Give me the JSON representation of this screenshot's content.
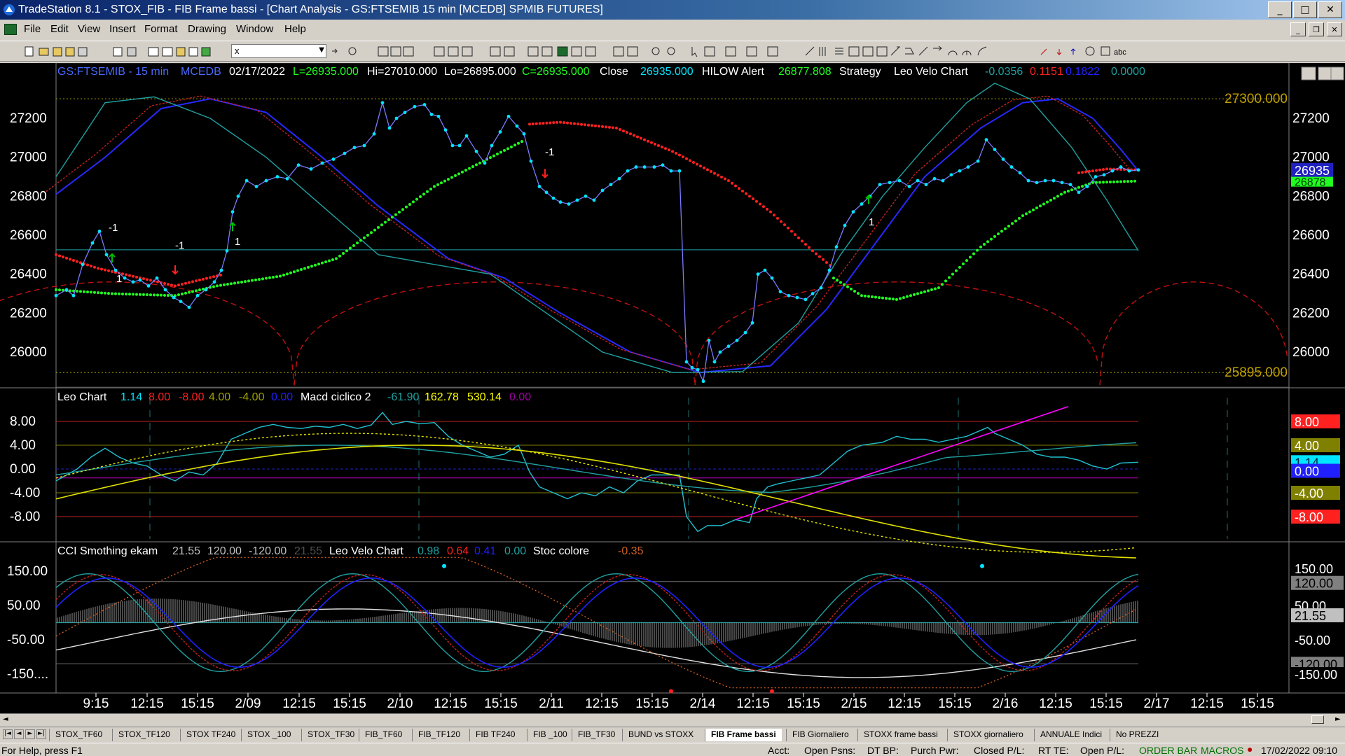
{
  "window": {
    "title": "TradeStation 8.1 - STOX_FIB - FIB Frame bassi - [Chart Analysis - GS:FTSEMIB  15 min  [MCEDB] SPMIB FUTURES]",
    "min": "_",
    "max": "□",
    "close": "✕"
  },
  "menu": [
    "File",
    "Edit",
    "View",
    "Insert",
    "Format",
    "Drawing",
    "Window",
    "Help"
  ],
  "toolbar": {
    "symbol": "x"
  },
  "price_panel": {
    "header": {
      "symbol": "GS:FTSEMIB - 15 min",
      "feed": "MCEDB",
      "date": "02/17/2022",
      "last": "L=26935.000",
      "high": "Hi=27010.000",
      "low": "Lo=26895.000",
      "close_val": "C=26935.000",
      "close_label": "Close",
      "close_num": "26935.000",
      "alert_label": "HILOW Alert",
      "alert_val": "26877.808",
      "strategy": "Strategy",
      "velo_label": "Leo Velo Chart",
      "v1": "-0.0356",
      "v2": "0.1151",
      "v3": "0.1822",
      "v4": "0.0000"
    },
    "y_ticks": [
      "27200",
      "27000",
      "26800",
      "26600",
      "26400",
      "26200",
      "26000"
    ],
    "hi_label": "27300.000",
    "lo_label": "25895.000",
    "last_price_tag": "26935",
    "alert_tag": "26878",
    "markers": [
      "-1",
      "1",
      "-1",
      "1",
      "-1",
      "1"
    ]
  },
  "osc_panel": {
    "header": {
      "name": "Leo Chart",
      "v1": "1.14",
      "v2": "8.00",
      "v3": "-8.00",
      "v4": "4.00",
      "v5": "-4.00",
      "v6": "0.00",
      "name2": "Macd ciclico 2",
      "m1": "-61.90",
      "m2": "162.78",
      "m3": "530.14",
      "m4": "0.00"
    },
    "y_ticks": [
      "8.00",
      "4.00",
      "0.00",
      "-4.00",
      "-8.00"
    ],
    "tags": [
      "8.00",
      "4.00",
      "1.14",
      "0.00",
      "-4.00",
      "-8.00"
    ]
  },
  "cci_panel": {
    "header": {
      "name": "CCI Smothing ekam",
      "v1": "21.55",
      "v2": "120.00",
      "v3": "-120.00",
      "v4": "21.55",
      "name2": "Leo Velo Chart",
      "l1": "0.98",
      "l2": "0.64",
      "l3": "0.41",
      "l4": "0.00",
      "name3": "Stoc colore",
      "s1": "-0.35"
    },
    "y_ticks": [
      "150.00",
      "50.00",
      "-50.00",
      "-150...."
    ],
    "tags": [
      "150.00",
      "120.00",
      "50.00",
      "21.55",
      "-50.00",
      "-120.00",
      "-150.00"
    ]
  },
  "time_axis": [
    "9:15",
    "12:15",
    "15:15",
    "2/09",
    "12:15",
    "15:15",
    "2/10",
    "12:15",
    "15:15",
    "2/11",
    "12:15",
    "15:15",
    "2/14",
    "12:15",
    "15:15",
    "2/15",
    "12:15",
    "15:15",
    "2/16",
    "12:15",
    "15:15",
    "2/17",
    "12:15",
    "15:15"
  ],
  "tabs": [
    "STOX_TF60",
    "STOX_TF120",
    "STOX TF240",
    "STOX _100",
    "STOX_TF30",
    "FIB_TF60",
    "FIB_TF120",
    "FIB TF240",
    "FIB _100",
    "FIB_TF30",
    "BUND vs STOXX",
    "FIB Frame bassi",
    "FIB Giornaliero",
    "STOXX frame bassi",
    "STOXX giornaliero",
    "ANNUALE Indici",
    "No PREZZI"
  ],
  "active_tab": "FIB Frame bassi",
  "status": {
    "help": "For Help, press F1",
    "acct": "Acct:",
    "open_psns": "Open Psns:",
    "dt_bp": "DT BP:",
    "purch_pwr": "Purch Pwr:",
    "closed_pl": "Closed P/L:",
    "rt_te": "RT TE:",
    "open_pl": "Open P/L:",
    "order_bar": "ORDER BAR",
    "macros": "MACROS",
    "datetime": "17/02/2022 09:10"
  },
  "colors": {
    "price": "#00e5ff",
    "red_dots": "#ff2020",
    "green_dots": "#20ff20",
    "blue_ma": "#2020ff",
    "teal": "#20a0a0",
    "yellow": "#ffff00",
    "magenta": "#ff00ff"
  }
}
